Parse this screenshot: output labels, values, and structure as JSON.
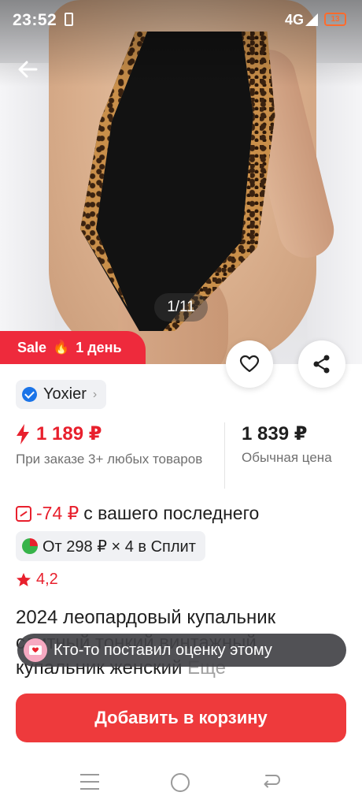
{
  "status_bar": {
    "time": "23:52",
    "network": "4G",
    "battery": "13"
  },
  "gallery": {
    "counter": "1/11",
    "sale_label": "Sale",
    "sale_icon": "fire-icon",
    "sale_duration": "1 день"
  },
  "brand": {
    "name": "Yoxier",
    "verified_icon": "verified-icon"
  },
  "price": {
    "promo_price": "1 189 ₽",
    "promo_note": "При заказе 3+ любых товаров",
    "regular_price": "1 839 ₽",
    "regular_label": "Обычная цена",
    "accent_color": "#e8202d"
  },
  "discount": {
    "amount": "-74 ₽",
    "text": "с вашего последнего"
  },
  "split": {
    "text": "От 298 ₽ × 4 в Сплит"
  },
  "rating": {
    "value": "4,2"
  },
  "product": {
    "title": "2024 леопардовый купальник слитный тонкий винтажный купальник женский",
    "more": "Еще"
  },
  "toast": {
    "text": "Кто-то поставил оценку этому"
  },
  "actions": {
    "add_to_cart": "Добавить в корзину",
    "button_color": "#ee3a3c"
  }
}
